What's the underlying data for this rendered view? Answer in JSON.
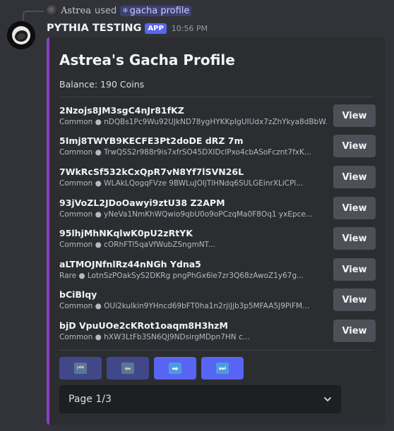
{
  "interaction": {
    "user": "Astrea",
    "used_text": "used",
    "command_icon": "slash-command-icon",
    "command": "gacha profile"
  },
  "header": {
    "bot_name": "PYTHIA TESTING",
    "tag": "APP",
    "timestamp": "10:56 PM"
  },
  "embed": {
    "accent_color": "#8b3fbf",
    "title": "Astrea's Gacha Profile",
    "balance": "Balance: 190 Coins",
    "items": [
      {
        "name": "2Nzojs8JM3sgC4nJr81fKZ",
        "details": "Common ● nDQBs1Pc9Wu92UJkND78ygHYKKpIgUIUdx7zZhYkya8dBbW...",
        "button": "View"
      },
      {
        "name": "5Imj8TWYB9KECFE3Pt2doDE dRZ 7m",
        "details": "Common ● TrwQSS2r988r9is7xfrSO45DXIDclPxo4cbASoFcznt7fxK...",
        "button": "View"
      },
      {
        "name": "7WkRcSf532kCxQpR7vN8Yf7lSVN26L",
        "details": "Common ● WLAkLQogqFVze 9BWLuJOIjTlHNdq6SULGEinrXLiCPl...",
        "button": "View"
      },
      {
        "name": "93jVoZL2JDoOawyi9ztU38 Z2APM",
        "details": "Common ● yNeVa1NmKhWQwio9qbU0o9oPCzqMa0F8Oq1 yxEpce...",
        "button": "View"
      },
      {
        "name": "95lhjMhNKqlwK0pU2zRtYK",
        "details": "Common ● cORhFTl5qaVfWubZSngmNT...",
        "button": "View"
      },
      {
        "name": "aLTMOJNfnlRz44nNGh Ydna5",
        "details": "Rare ● LotnSzPOakSyS2DKRg pngPhGx6le7zr3Q68zAwoZ1y67g...",
        "button": "View"
      },
      {
        "name": "bCiBlqy",
        "details": "Common ● OUi2kulkin9YHncd69bFT0ha1n2rjiJjb3p5MFAA5J9PiFM...",
        "button": "View"
      },
      {
        "name": "bjD VpuUOe2cKRot1oaqm8H3hzM",
        "details": "Common ● hXW3LtFb3SN6QJ9NDsirgMDpn7HN c...",
        "button": "View"
      }
    ],
    "navigation": [
      {
        "icon": "first-page-icon",
        "glyph": "⏮",
        "state": "disabled"
      },
      {
        "icon": "previous-page-icon",
        "glyph": "⬅",
        "state": "disabled"
      },
      {
        "icon": "next-page-icon",
        "glyph": "➡",
        "state": "enabled"
      },
      {
        "icon": "last-page-icon",
        "glyph": "⏭",
        "state": "enabled"
      }
    ],
    "page_select": {
      "value": "Page 1/3"
    }
  }
}
